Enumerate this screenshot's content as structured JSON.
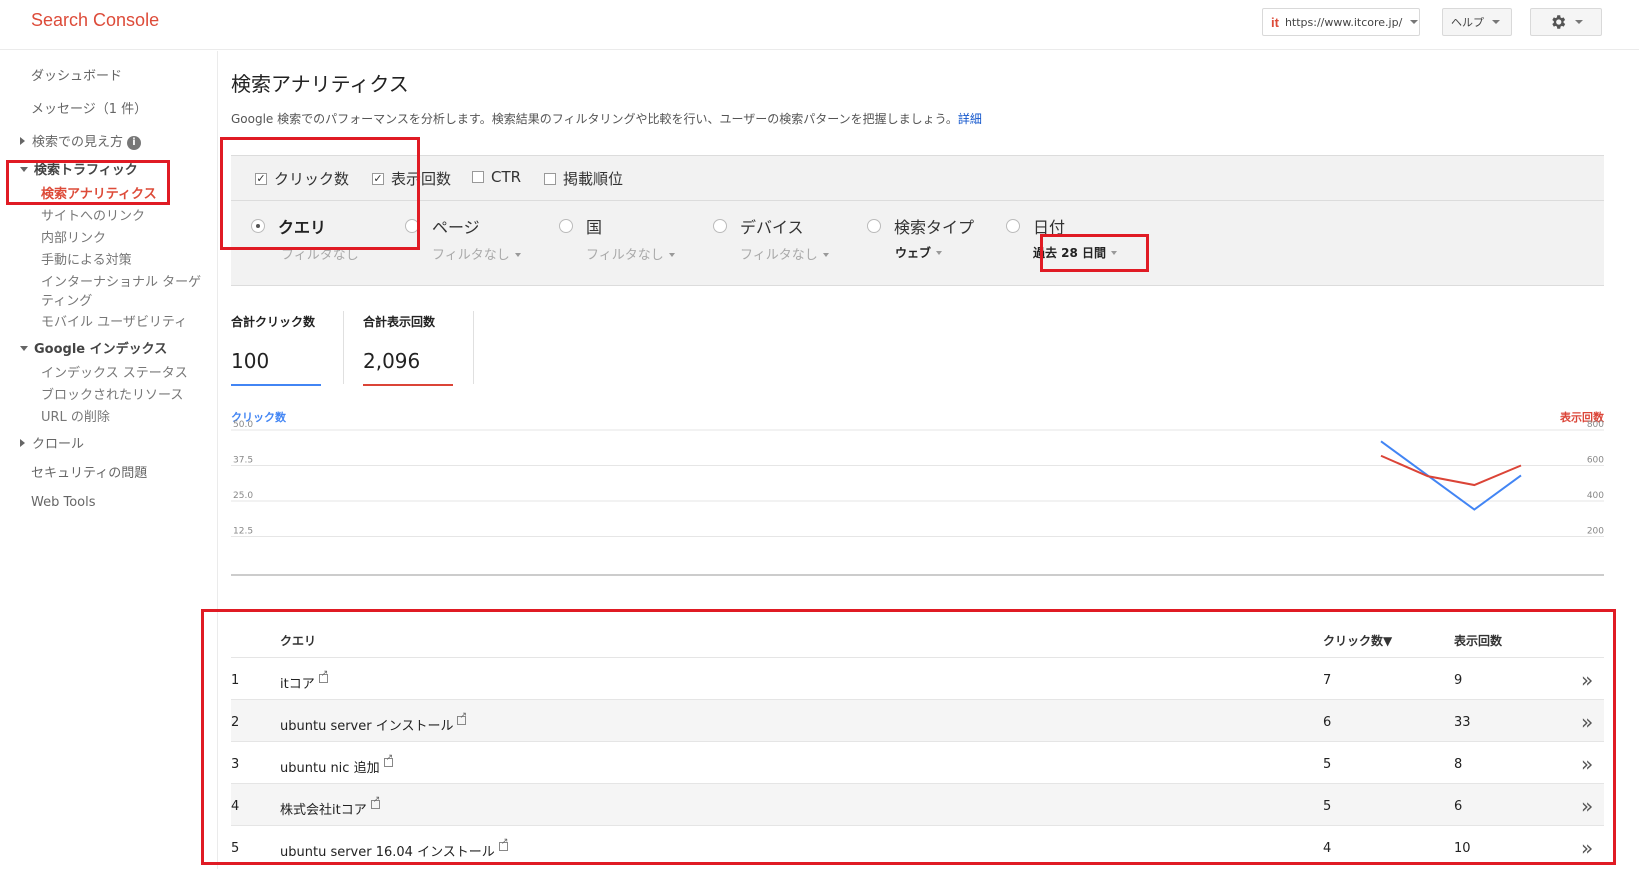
{
  "header": {
    "app_title": "Search Console",
    "site_label": "https://www.itcore.jp/",
    "site_logo": "it",
    "help_label": "ヘルプ",
    "gear_icon": "gear-icon"
  },
  "sidebar": {
    "dashboard": "ダッシュボード",
    "messages": "メッセージ（1 件）",
    "search_appearance": "検索での見え方",
    "search_traffic": "検索トラフィック",
    "search_analytics": "検索アナリティクス",
    "links_to_site": "サイトへのリンク",
    "internal_links": "内部リンク",
    "manual_actions": "手動による対策",
    "international_targeting_1": "インターナショナル ターゲ",
    "international_targeting_2": "ティング",
    "mobile_usability": "モバイル ユーザビリティ",
    "google_index": "Google インデックス",
    "index_status": "インデックス ステータス",
    "blocked_resources": "ブロックされたリソース",
    "remove_urls": "URL の削除",
    "crawl": "クロール",
    "security_issues": "セキュリティの問題",
    "web_tools": "Web Tools"
  },
  "main": {
    "title": "検索アナリティクス",
    "description": "Google 検索でのパフォーマンスを分析します。検索結果のフィルタリングや比較を行い、ユーザーの検索パターンを把握しましょう。",
    "details_link": "詳細"
  },
  "metrics": {
    "clicks": {
      "label": "クリック数",
      "checked": true
    },
    "impressions": {
      "label": "表示回数",
      "checked": true
    },
    "ctr": {
      "label": "CTR",
      "checked": false
    },
    "position": {
      "label": "掲載順位",
      "checked": false
    }
  },
  "group_by": {
    "query": {
      "label": "クエリ",
      "filter": "フィルタなし",
      "selected": true
    },
    "page": {
      "label": "ページ",
      "filter": "フィルタなし"
    },
    "country": {
      "label": "国",
      "filter": "フィルタなし"
    },
    "device": {
      "label": "デバイス",
      "filter": "フィルタなし"
    },
    "search_type": {
      "label": "検索タイプ",
      "filter": "ウェブ"
    },
    "date": {
      "label": "日付",
      "filter": "過去 28 日間"
    }
  },
  "summary": {
    "total_clicks_label": "合計クリック数",
    "total_clicks_value": "100",
    "total_impressions_label": "合計表示回数",
    "total_impressions_value": "2,096",
    "clicks_color": "#4285f4",
    "impressions_color": "#db4437"
  },
  "chart_data": {
    "type": "line",
    "left_axis_label": "クリック数",
    "right_axis_label": "表示回数",
    "left_ticks": [
      "50.0",
      "37.5",
      "25.0",
      "12.5"
    ],
    "right_ticks": [
      "800",
      "600",
      "400",
      "200"
    ],
    "left_ylim": [
      0,
      50
    ],
    "right_ylim": [
      0,
      800
    ],
    "series": [
      {
        "name": "クリック数",
        "axis": "left",
        "color": "#4285f4",
        "values": [
          46,
          34,
          22,
          34
        ]
      },
      {
        "name": "表示回数",
        "axis": "right",
        "color": "#db4437",
        "values": [
          655,
          540,
          490,
          600
        ]
      }
    ]
  },
  "table": {
    "headers": {
      "query": "クエリ",
      "clicks": "クリック数▼",
      "impressions": "表示回数"
    },
    "rows": [
      {
        "rank": "1",
        "query": "itコア",
        "clicks": "7",
        "impressions": "9"
      },
      {
        "rank": "2",
        "query": "ubuntu server インストール",
        "clicks": "6",
        "impressions": "33"
      },
      {
        "rank": "3",
        "query": "ubuntu nic 追加",
        "clicks": "5",
        "impressions": "8"
      },
      {
        "rank": "4",
        "query": "株式会社itコア",
        "clicks": "5",
        "impressions": "6"
      },
      {
        "rank": "5",
        "query": "ubuntu server 16.04 インストール",
        "clicks": "4",
        "impressions": "10"
      }
    ]
  }
}
